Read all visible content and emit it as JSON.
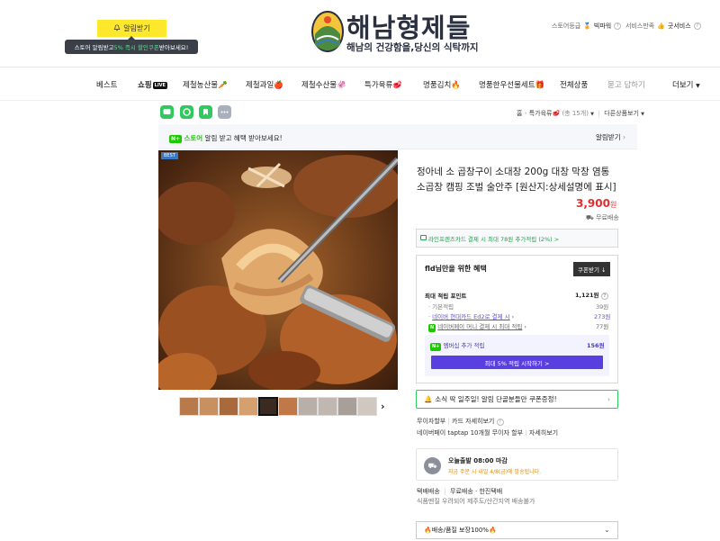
{
  "header": {
    "alarm_button": "알림받기",
    "tooltip_prefix": "스토어 알림받고 ",
    "tooltip_green": "5% 즉시 할인쿠폰",
    "tooltip_suffix": " 받아보세요!",
    "logo_title": "해남형제들",
    "logo_sub": "해남의 건강함을,당신의 식탁까지",
    "store_grade_label": "스토어등급",
    "store_grade_value": "빅파워",
    "service_label": "서비스만족",
    "service_value": "굿서비스",
    "help_mark": "?"
  },
  "nav": {
    "items": [
      "베스트",
      "쇼핑",
      "제철농산물🥕",
      "제철과일🍎",
      "제철수산물🦑",
      "특가육류🥩",
      "명품김치🔥",
      "명품한우선물세트🎁",
      "전체상품",
      "묻고 답하기"
    ],
    "live_badge": "LIVE",
    "more": "더보기"
  },
  "breadcrumb": {
    "home": "홈",
    "category": "특가육류🥩",
    "count": "(총 15개)",
    "other": "다른상품보기"
  },
  "store_bar": {
    "npay": "N+",
    "store": "스토어",
    "text": "알림 받고 혜택 받아보세요!",
    "alarm": "알림받기"
  },
  "product": {
    "best_badge": "BEST",
    "title": "정아네 소 곱창구이 소대창 200g 대창 막창 염통 소곱창 캠핑 조벌 술안주 [원산지:상세설명에 표시]",
    "price": "3,900",
    "price_unit": "원",
    "shipping": "무료배송",
    "thumb_colors": [
      "#b87a4a",
      "#c89060",
      "#a86a3c",
      "#d4a070",
      "#3a2a20",
      "#c07848",
      "#b8b0a8",
      "#c0b8b0",
      "#a8a098",
      "#d0c8c0"
    ]
  },
  "card_banner": "라인프렌즈카드 결제 시 최대 78원 추가적립 (2%) >",
  "benefit": {
    "title": "fld님만을 위한 혜택",
    "coupon_btn": "쿠폰받기",
    "max_points_label": "최대 적립 포인트",
    "max_points_value": "1,121원",
    "rows": [
      {
        "label": "기본적립",
        "value": "39원"
      },
      {
        "label": "네이버 현대카드 Ed2로 결제 시",
        "value": "273원"
      },
      {
        "label": "네이버페이 머니 결제 시 최대 적립",
        "value": "77원"
      }
    ],
    "membership_label": "멤버십 추가 적립",
    "membership_value": "156원",
    "membership_btn": "최대 5% 적립 시작하기 >"
  },
  "coupon_banner": "소식 딱 일주일! 알림 단골분들만 쿠폰증정!",
  "installment": {
    "label1": "무이자할부",
    "detail1": "카드 자세히보기",
    "label2": "네이버페이 taptap 10개월 무이자 할부",
    "detail2": "자세히보기"
  },
  "delivery": {
    "title": "오늘출발 08:00 마감",
    "sub": "지금 주문 시 내일 4/8(금)에 발송됩니다.",
    "ship_label": "택배배송",
    "ship_value": "무료배송 · 한진택배",
    "note": "식품멘질 우려되어 제주도/산간지역 배송불가"
  },
  "option": "🔥배송/품질 보장100%🔥"
}
